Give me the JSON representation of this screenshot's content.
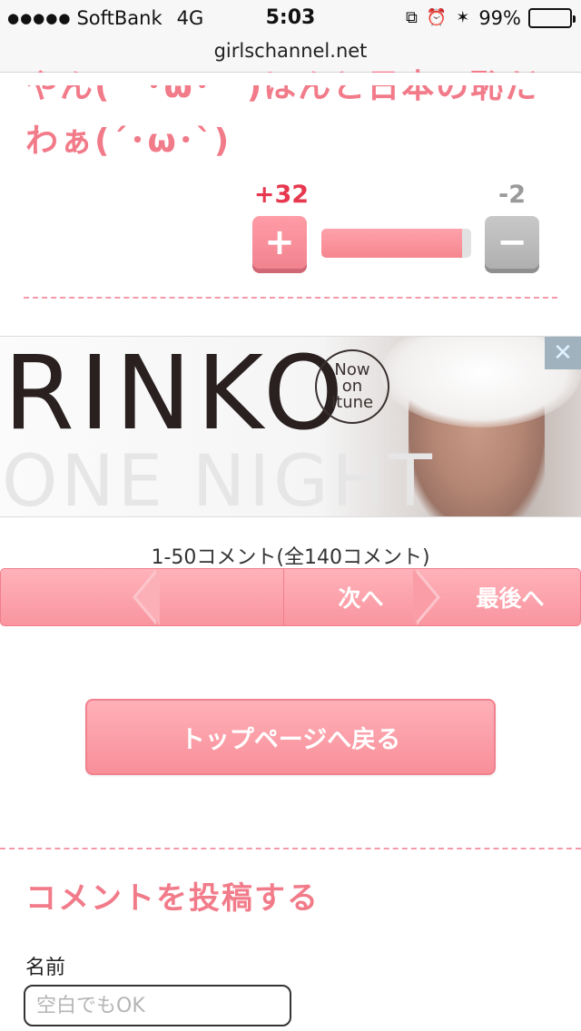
{
  "status_bar": {
    "signal": "●●●●●",
    "carrier": "SoftBank",
    "network": "4G",
    "time": "5:03",
    "battery": "99%",
    "battery_level": 0.99,
    "icons": [
      "orientation-lock-icon",
      "alarm-icon",
      "bluetooth-icon",
      "battery-icon"
    ]
  },
  "browser": {
    "url": "girlschannel.net"
  },
  "comment": {
    "lines": [
      "やん(　･ω･　)ほんと日本の恥だ",
      "わぁ(´･ω･`)"
    ]
  },
  "vote": {
    "plus_count": "+32",
    "minus_count": "-2",
    "plus_label": "+",
    "minus_label": "−",
    "plus_ratio": 0.94,
    "colors": {
      "plus": "#f1838f",
      "minus": "#b0b0b0",
      "plus_count": "#e6394f"
    }
  },
  "ad": {
    "title": "RINKO",
    "subtitle": "ONE NIGHT",
    "badge": [
      "Now",
      "on",
      "Itune"
    ],
    "close_label": "✕"
  },
  "pagination": {
    "count_text": "1-50コメント(全140コメント)",
    "next_label": "次へ",
    "last_label": "最後へ"
  },
  "top_button": {
    "label": "トップページへ戻る"
  },
  "post_form": {
    "heading": "コメントを投稿する",
    "name_label": "名前",
    "name_placeholder": "空白でもOK"
  },
  "theme": {
    "accent": "#f27b8a",
    "button_pink": "#f9959f"
  }
}
